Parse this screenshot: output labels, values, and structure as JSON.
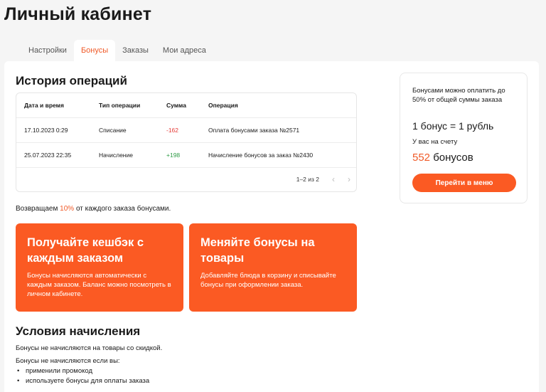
{
  "page_title": "Личный кабинет",
  "tabs": [
    {
      "label": "Настройки"
    },
    {
      "label": "Бонусы"
    },
    {
      "label": "Заказы"
    },
    {
      "label": "Мои адреса"
    }
  ],
  "history": {
    "title": "История операций",
    "columns": [
      "Дата и время",
      "Тип операции",
      "Сумма",
      "Операция"
    ],
    "rows": [
      {
        "date": "17.10.2023 0:29",
        "type": "Списание",
        "amount": "-162",
        "operation": "Оплата бонусами заказа №2571"
      },
      {
        "date": "25.07.2023 22:35",
        "type": "Начисление",
        "amount": "+198",
        "operation": "Начисление бонусов за заказ №2430"
      }
    ],
    "pagination": {
      "label": "1–2 из 2",
      "prev_icon": "chevron-left-icon",
      "next_icon": "chevron-right-icon"
    }
  },
  "cashback_note": {
    "before": "Возвращаем ",
    "percent": "10%",
    "after": " от каждого заказа бонусами."
  },
  "promos": [
    {
      "title": "Получайте кешбэк с каждым заказом",
      "text": "Бонусы начисляются автоматически с каждым заказом. Баланс можно посмотреть в личном кабинете."
    },
    {
      "title": "Меняйте бонусы на товары",
      "text": "Добавляйте блюда в корзину и списывайте бонусы при оформлении заказа."
    }
  ],
  "conditions": {
    "title": "Условия начисления",
    "line1": "Бонусы не начисляются на товары со скидкой.",
    "line2": "Бонусы не начисляются если вы:",
    "bullets": [
      "применили промокод",
      "используете бонусы для оплаты заказа"
    ]
  },
  "side": {
    "note": "Бонусами можно оплатить до 50% от общей суммы заказа",
    "rate": "1 бонус = 1 рубль",
    "balance_label": "У вас на счету",
    "balance_value": "552",
    "balance_unit": "бонусов",
    "button_label": "Перейти в меню"
  },
  "colors": {
    "accent": "#fb5a23",
    "negative": "#e53935",
    "positive": "#2e9b45"
  }
}
